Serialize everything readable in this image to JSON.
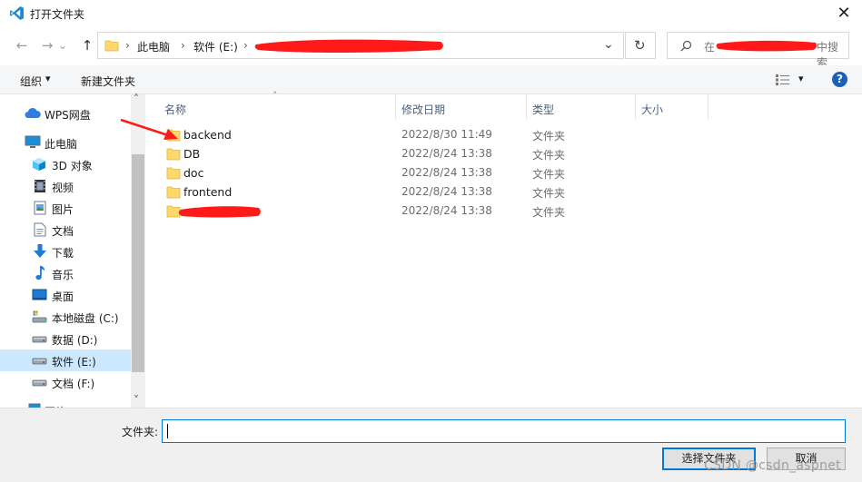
{
  "window": {
    "title": "打开文件夹",
    "close_glyph": "✕"
  },
  "nav": {
    "back_glyph": "←",
    "forward_glyph": "→",
    "recent_glyph": "⌄",
    "up_glyph": "↑",
    "breadcrumb": [
      "此电脑",
      "软件 (E:)"
    ],
    "breadcrumb_sep": "›",
    "dropdown_glyph": "⌄",
    "refresh_glyph": "↻",
    "search_placeholder_prefix": "在",
    "search_placeholder_suffix": "中搜索"
  },
  "toolbar": {
    "organize_label": "组织",
    "organize_arrow": "▾",
    "new_folder_label": "新建文件夹",
    "view_arrow": "▾",
    "help_glyph": "?"
  },
  "sidebar": {
    "items": [
      {
        "label": "WPS网盘",
        "icon": "cloud-icon"
      },
      {
        "label": "此电脑",
        "icon": "computer-icon"
      },
      {
        "label": "3D 对象",
        "icon": "cube-icon"
      },
      {
        "label": "视频",
        "icon": "video-icon"
      },
      {
        "label": "图片",
        "icon": "picture-icon"
      },
      {
        "label": "文档",
        "icon": "document-icon"
      },
      {
        "label": "下载",
        "icon": "download-icon"
      },
      {
        "label": "音乐",
        "icon": "music-icon"
      },
      {
        "label": "桌面",
        "icon": "desktop-icon"
      },
      {
        "label": "本地磁盘 (C:)",
        "icon": "system-drive-icon"
      },
      {
        "label": "数据 (D:)",
        "icon": "drive-icon"
      },
      {
        "label": "软件 (E:)",
        "icon": "drive-icon",
        "selected": true
      },
      {
        "label": "文档 (F:)",
        "icon": "drive-icon"
      },
      {
        "label": "网络",
        "icon": "network-icon"
      }
    ],
    "scroll_up_glyph": "˄",
    "scroll_down_glyph": "˅"
  },
  "columns": {
    "sort_glyph": "˄",
    "name": "名称",
    "modified": "修改日期",
    "type": "类型",
    "size": "大小"
  },
  "files": [
    {
      "name": "backend",
      "modified": "2022/8/30 11:49",
      "type": "文件夹"
    },
    {
      "name": "DB",
      "modified": "2022/8/24 13:38",
      "type": "文件夹"
    },
    {
      "name": "doc",
      "modified": "2022/8/24 13:38",
      "type": "文件夹"
    },
    {
      "name": "frontend",
      "modified": "2022/8/24 13:38",
      "type": "文件夹"
    },
    {
      "name": "",
      "modified": "2022/8/24 13:38",
      "type": "文件夹",
      "redacted": true
    }
  ],
  "footer": {
    "folder_label": "文件夹:",
    "folder_value": "",
    "select_button": "选择文件夹",
    "cancel_button": "取消"
  },
  "watermark": "CSDN @csdn_aspnet",
  "colors": {
    "vscode_blue": "#1f8ad2",
    "folder_yellow": "#ffd86b",
    "selection": "#cce8ff",
    "redaction_red": "#ff1a1a",
    "annotation_red": "#ff1a1a",
    "focus_blue": "#0078d7",
    "help_blue": "#1c5fb8"
  }
}
